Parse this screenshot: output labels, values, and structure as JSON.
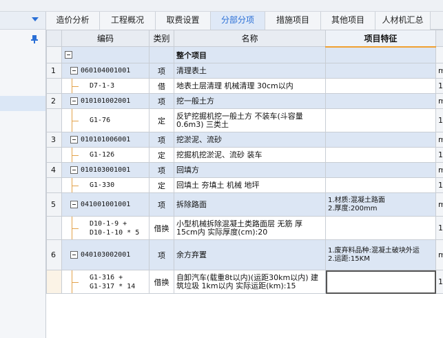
{
  "tabs": [
    {
      "label": "造价分析",
      "active": false
    },
    {
      "label": "工程概况",
      "active": false
    },
    {
      "label": "取费设置",
      "active": false
    },
    {
      "label": "分部分项",
      "active": true
    },
    {
      "label": "措施项目",
      "active": false
    },
    {
      "label": "其他项目",
      "active": false
    },
    {
      "label": "人材机汇总",
      "active": false
    }
  ],
  "columns": {
    "code": "编码",
    "type": "类别",
    "name": "名称",
    "feature": "项目特征"
  },
  "root": {
    "name": "整个项目"
  },
  "rows": [
    {
      "kind": "parent",
      "num": "1",
      "code": "060104001001",
      "type": "项",
      "name": "清理表土",
      "feature": ""
    },
    {
      "kind": "sub",
      "num": "",
      "code": "D7-1-3",
      "type": "借",
      "name": "地表土层清理 机械清理 30cm以内",
      "feature": ""
    },
    {
      "kind": "parent",
      "num": "2",
      "code": "010101002001",
      "type": "项",
      "name": "挖一般土方",
      "feature": ""
    },
    {
      "kind": "sub",
      "num": "",
      "code": "G1-76",
      "type": "定",
      "name": "反铲挖掘机挖一般土方 不装车(斗容量0.6m3) 三类土",
      "feature": ""
    },
    {
      "kind": "parent",
      "num": "3",
      "code": "010101006001",
      "type": "项",
      "name": "挖淤泥、流砂",
      "feature": ""
    },
    {
      "kind": "sub",
      "num": "",
      "code": "G1-126",
      "type": "定",
      "name": "挖掘机挖淤泥、流砂 装车",
      "feature": ""
    },
    {
      "kind": "parent",
      "num": "4",
      "code": "010103001001",
      "type": "项",
      "name": "回填方",
      "feature": ""
    },
    {
      "kind": "sub",
      "num": "",
      "code": "G1-330",
      "type": "定",
      "name": "回填土 夯填土 机械 地坪",
      "feature": ""
    },
    {
      "kind": "parent",
      "num": "5",
      "code": "041001001001",
      "type": "项",
      "name": "拆除路面",
      "feature": "1.材质:混凝土路面\n2.厚度:200mm"
    },
    {
      "kind": "sub",
      "num": "",
      "code": "D10-1-9 +\nD10-1-10 * 5",
      "type": "借换",
      "name": "小型机械拆除混凝土类路面层 无筋 厚15cm内  实际厚度(cm):20",
      "feature": ""
    },
    {
      "kind": "parent",
      "num": "6",
      "code": "040103002001",
      "type": "项",
      "name": "余方弃置",
      "feature": "1.废弃料品种:混凝土破块外运\n2.运距:15KM"
    },
    {
      "kind": "sub",
      "num": "",
      "code": "G1-316 +\nG1-317 * 14",
      "type": "借换",
      "name": "自卸汽车(载重8t以内)(运距30km以内) 建筑垃圾 1km以内  实际运距(km):15",
      "feature": ""
    }
  ],
  "right_edge": [
    "m",
    "1",
    "m",
    "1",
    "m",
    "1",
    "m",
    "1",
    "m",
    "1",
    "m",
    "1"
  ],
  "icons": {
    "dropdown": "chevron-down-icon",
    "pin": "pin-icon",
    "collapse": "minus-box-icon"
  },
  "colors": {
    "accent": "#2a6fd6",
    "selected_row": "#dce6f4",
    "tree_line": "#e3a24a"
  }
}
